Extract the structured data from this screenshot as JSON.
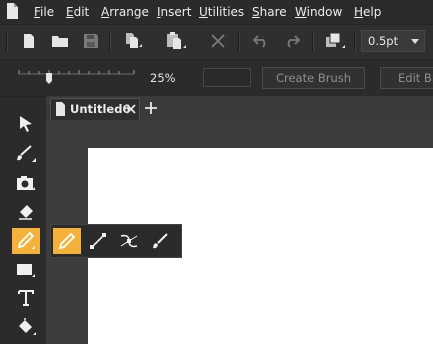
{
  "menu": {
    "items": [
      {
        "label": "File",
        "mnemonic": "F",
        "rest": "ile"
      },
      {
        "label": "Edit",
        "mnemonic": "E",
        "rest": "dit"
      },
      {
        "label": "Arrange",
        "mnemonic": "A",
        "rest": "rrange"
      },
      {
        "label": "Insert",
        "mnemonic": "I",
        "rest": "nsert"
      },
      {
        "label": "Utilities",
        "mnemonic": "U",
        "rest": "tilities"
      },
      {
        "label": "Share",
        "mnemonic": "S",
        "rest": "hare"
      },
      {
        "label": "Window",
        "mnemonic": "W",
        "rest": "indow"
      },
      {
        "label": "Help",
        "mnemonic": "H",
        "rest": "elp"
      }
    ]
  },
  "toolbar": {
    "stroke_width": "0.5pt",
    "icons": [
      "new-document-icon",
      "open-folder-icon",
      "save-icon",
      "copy-icon",
      "paste-icon",
      "delete-icon",
      "undo-icon",
      "redo-icon",
      "arrange-icon"
    ]
  },
  "brushbar": {
    "zoom": "25%",
    "create_brush": "Create Brush",
    "edit_brush": "Edit Brush"
  },
  "document": {
    "tab_title": "Untitled6"
  },
  "tools": [
    "selection-arrow-icon",
    "brush-tool-icon",
    "camera-icon",
    "eraser-icon",
    "pencil-icon",
    "rectangle-icon",
    "text-tool-icon",
    "fill-bucket-icon"
  ],
  "flyout": [
    "pencil-icon",
    "line-icon",
    "curve-icon",
    "pen-icon"
  ],
  "colors": {
    "accent": "#f6b13b",
    "background": "#2b2b2b"
  }
}
